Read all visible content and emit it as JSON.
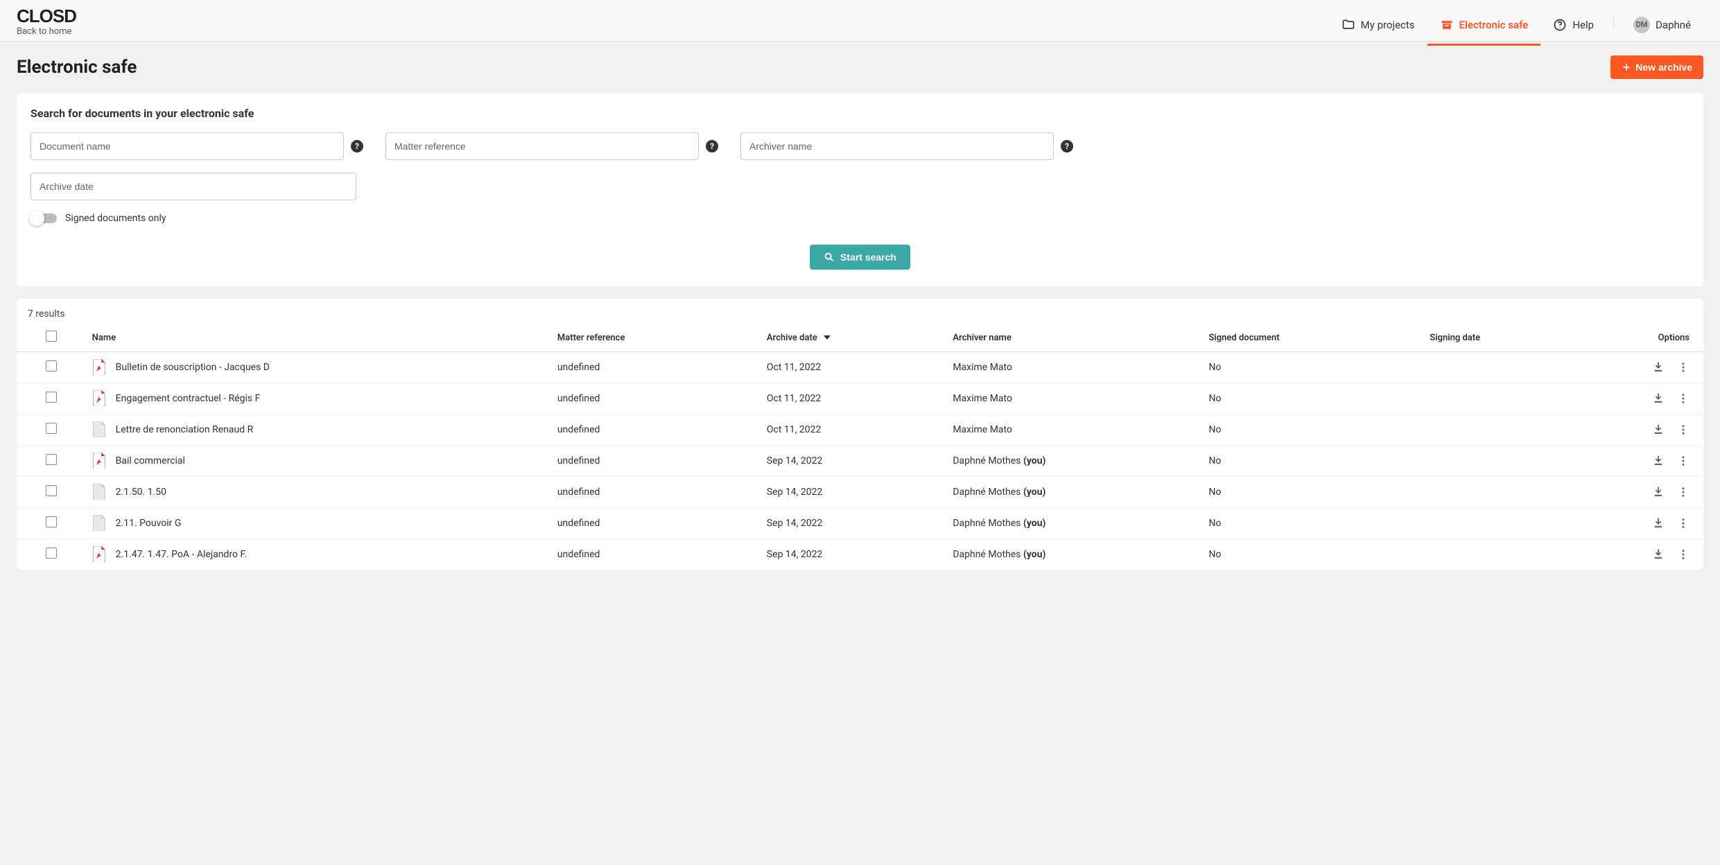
{
  "header": {
    "logo_text": "CLOSD",
    "back_home": "Back to home",
    "nav": {
      "my_projects": "My projects",
      "electronic_safe": "Electronic safe",
      "help": "Help"
    },
    "user": {
      "initials": "DM",
      "name": "Daphné"
    }
  },
  "page": {
    "title": "Electronic safe",
    "new_archive_btn": "New archive"
  },
  "search": {
    "panel_title": "Search for documents in your electronic safe",
    "doc_name_ph": "Document name",
    "matter_ref_ph": "Matter reference",
    "archiver_ph": "Archiver name",
    "archive_date_ph": "Archive date",
    "toggle_label": "Signed documents only",
    "start_btn": "Start search"
  },
  "results": {
    "count_text": "7 results",
    "columns": {
      "name": "Name",
      "matter": "Matter reference",
      "archive_date": "Archive date",
      "archiver": "Archiver name",
      "signed": "Signed document",
      "signing_date": "Signing date",
      "options": "Options"
    },
    "rows": [
      {
        "icon": "pdf",
        "name": "Bulletin de souscription - Jacques D",
        "matter": "undefined",
        "date": "Oct 11, 2022",
        "archiver": "Maxime Mato",
        "you": false,
        "signed": "No",
        "signing_date": ""
      },
      {
        "icon": "pdf",
        "name": "Engagement contractuel - Régis F",
        "matter": "undefined",
        "date": "Oct 11, 2022",
        "archiver": "Maxime Mato",
        "you": false,
        "signed": "No",
        "signing_date": ""
      },
      {
        "icon": "doc",
        "name": "Lettre de renonciation Renaud R",
        "matter": "undefined",
        "date": "Oct 11, 2022",
        "archiver": "Maxime Mato",
        "you": false,
        "signed": "No",
        "signing_date": ""
      },
      {
        "icon": "pdf",
        "name": "Bail commercial",
        "matter": "undefined",
        "date": "Sep 14, 2022",
        "archiver": "Daphné Mothes",
        "you": true,
        "signed": "No",
        "signing_date": ""
      },
      {
        "icon": "doc",
        "name": "2.1.50. 1.50",
        "matter": "undefined",
        "date": "Sep 14, 2022",
        "archiver": "Daphné Mothes",
        "you": true,
        "signed": "No",
        "signing_date": ""
      },
      {
        "icon": "doc",
        "name": "2.11. Pouvoir G",
        "matter": "undefined",
        "date": "Sep 14, 2022",
        "archiver": "Daphné Mothes",
        "you": true,
        "signed": "No",
        "signing_date": ""
      },
      {
        "icon": "pdf",
        "name": "2.1.47. 1.47. PoA - Alejandro F.",
        "matter": "undefined",
        "date": "Sep 14, 2022",
        "archiver": "Daphné Mothes",
        "you": true,
        "signed": "No",
        "signing_date": ""
      }
    ],
    "you_suffix": "(you)"
  }
}
